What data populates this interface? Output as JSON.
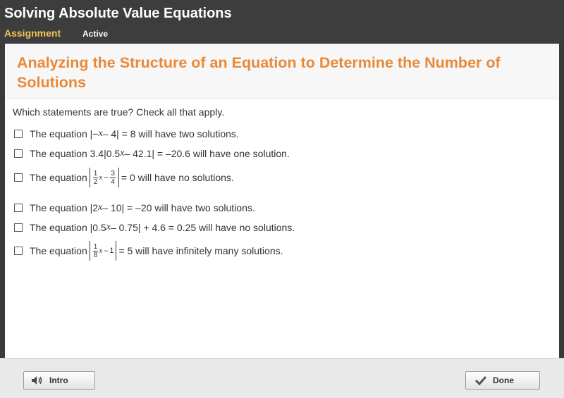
{
  "header": {
    "title": "Solving Absolute Value Equations",
    "assignment_label": "Assignment",
    "status": "Active"
  },
  "lesson": {
    "title": "Analyzing the Structure of an Equation to Determine the Number of Solutions"
  },
  "question": {
    "prompt": "Which statements are true? Check all that apply.",
    "options": [
      {
        "prefix": "The equation |−",
        "var": "x",
        "rest": " – 4| = 8 will have two solutions."
      },
      {
        "prefix": "The equation 3.4|0.5",
        "var": "x",
        "rest": " – 42.1| = –20.6 will have one solution."
      },
      {
        "prefix": "The equation",
        "frac1_num": "1",
        "frac1_den": "2",
        "var": "x",
        "minus": "–",
        "frac2_num": "3",
        "frac2_den": "4",
        "rest": "= 0 will have no solutions."
      },
      {
        "prefix": "The equation |2",
        "var": "x",
        "rest": " – 10| = –20 will have two solutions."
      },
      {
        "prefix": "The equation |0.5",
        "var": "x",
        "rest": " – 0.75| + 4.6 = 0.25 will have no solutions."
      },
      {
        "prefix": "The equation",
        "frac1_num": "1",
        "frac1_den": "8",
        "var": "x",
        "minus": "–",
        "tail": "1",
        "rest": "= 5 will have infinitely many solutions."
      }
    ]
  },
  "footer": {
    "intro_label": "Intro",
    "done_label": "Done",
    "intro_icon": "speaker-icon",
    "done_icon": "checkmark-icon"
  }
}
